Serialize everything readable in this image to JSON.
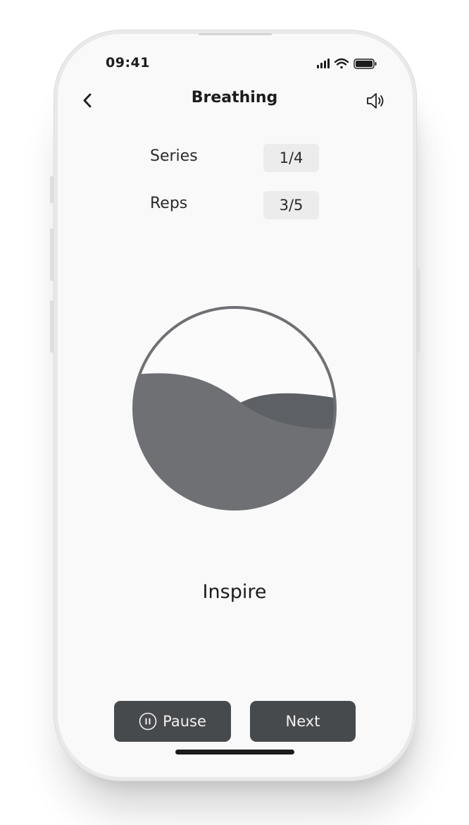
{
  "status_bar": {
    "time": "09:41",
    "icons": [
      "signal-icon",
      "wifi-icon",
      "battery-icon"
    ]
  },
  "nav": {
    "back_icon": "chevron-left-icon",
    "title": "Breathing",
    "sound_icon": "speaker-icon"
  },
  "stats": {
    "series": {
      "label": "Series",
      "value": "1/4"
    },
    "reps": {
      "label": "Reps",
      "value": "3/5"
    }
  },
  "breath": {
    "phase": "Inspire"
  },
  "actions": {
    "pause_label": "Pause",
    "pause_icon": "pause-circle-icon",
    "next_label": "Next"
  },
  "colors": {
    "background": "#f9f9f9",
    "button": "#474a4d",
    "wave_front": "#6e7074",
    "wave_back": "#5d6064",
    "stat_box": "#ececec",
    "circle_stroke": "#6e7074"
  }
}
